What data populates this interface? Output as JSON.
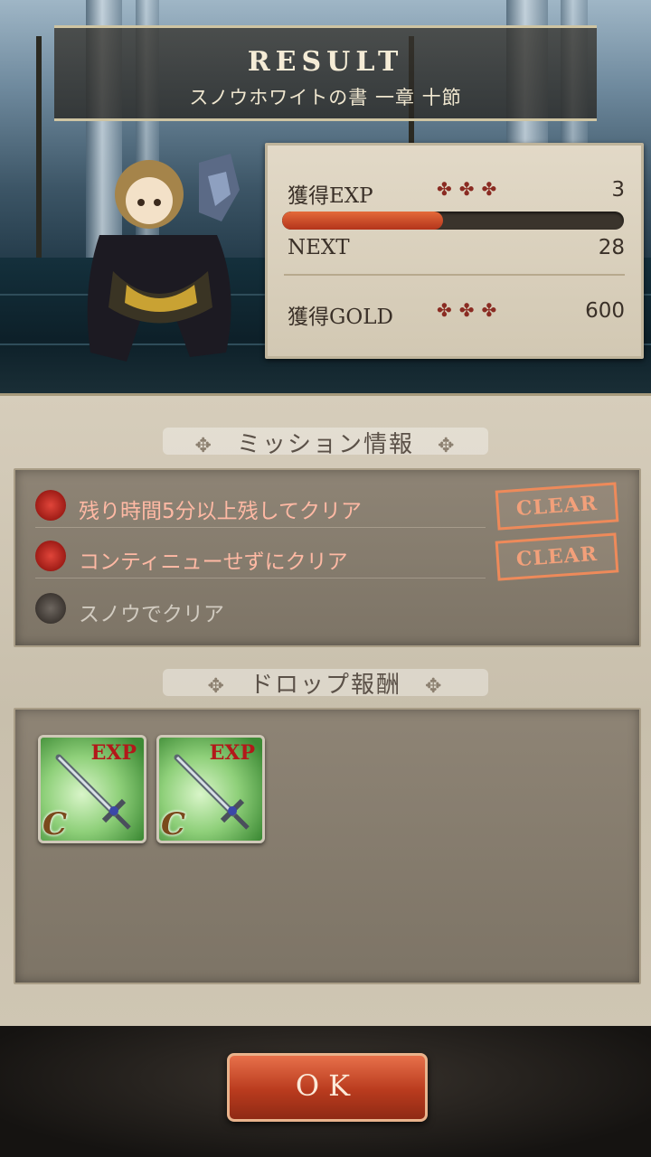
{
  "header": {
    "title": "RESULT",
    "subtitle": "スノウホワイトの書 一章 十節"
  },
  "stats": {
    "exp_label": "獲得EXP",
    "exp_value": "3",
    "exp_progress": 0.47,
    "next_label": "NEXT",
    "next_value": "28",
    "gold_label": "獲得GOLD",
    "gold_value": "600",
    "crosses": "✤✤✤"
  },
  "missions": {
    "title": "ミッション情報",
    "items": [
      {
        "text": "残り時間5分以上残してクリア",
        "status": "CLEAR"
      },
      {
        "text": "コンティニューせずにクリア",
        "status": "CLEAR"
      },
      {
        "text": "スノウでクリア",
        "status": ""
      }
    ]
  },
  "drops": {
    "title": "ドロップ報酬",
    "items": [
      {
        "badge": "EXP",
        "rank": "C",
        "icon": "sword-icon"
      },
      {
        "badge": "EXP",
        "rank": "C",
        "icon": "sword-icon"
      }
    ]
  },
  "ok_button": "OK",
  "colors": {
    "accent": "#c2462a",
    "clear_stamp": "#ee8a5a",
    "exp_fill": "#d2542e"
  }
}
